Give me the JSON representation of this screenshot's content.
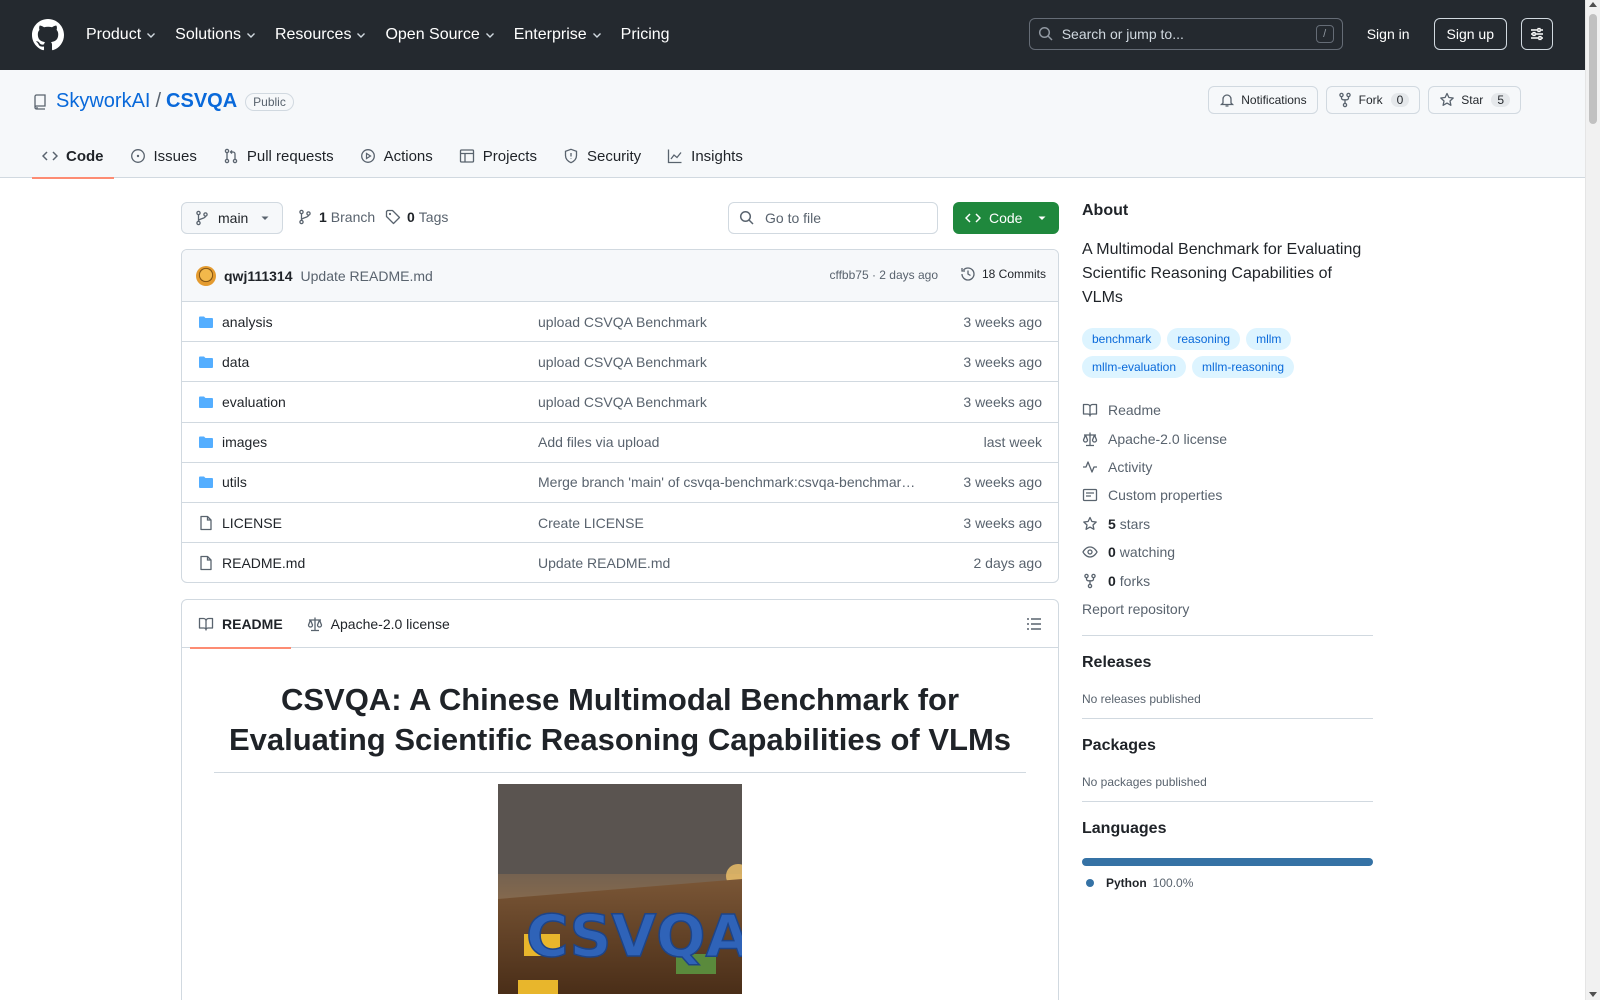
{
  "header": {
    "nav": [
      "Product",
      "Solutions",
      "Resources",
      "Open Source",
      "Enterprise",
      "Pricing"
    ],
    "search_placeholder": "Search or jump to...",
    "search_shortcut": "/",
    "sign_in": "Sign in",
    "sign_up": "Sign up"
  },
  "repo": {
    "owner": "SkyworkAI",
    "separator": "/",
    "name": "CSVQA",
    "visibility": "Public",
    "notifications_label": "Notifications",
    "fork_label": "Fork",
    "fork_count": "0",
    "star_label": "Star",
    "star_count": "5",
    "tabs": [
      "Code",
      "Issues",
      "Pull requests",
      "Actions",
      "Projects",
      "Security",
      "Insights"
    ]
  },
  "toolbar": {
    "branch": "main",
    "branch_count": "1",
    "branch_label": "Branch",
    "tag_count": "0",
    "tag_label": "Tags",
    "goto_placeholder": "Go to file",
    "code_button": "Code"
  },
  "latest_commit": {
    "author": "qwj111314",
    "message": "Update README.md",
    "meta": "cffbb75 · 2 days ago",
    "commits_label": "18 Commits"
  },
  "files": [
    {
      "name": "analysis",
      "type": "folder",
      "message": "upload CSVQA Benchmark",
      "age": "3 weeks ago"
    },
    {
      "name": "data",
      "type": "folder",
      "message": "upload CSVQA Benchmark",
      "age": "3 weeks ago"
    },
    {
      "name": "evaluation",
      "type": "folder",
      "message": "upload CSVQA Benchmark",
      "age": "3 weeks ago"
    },
    {
      "name": "images",
      "type": "folder",
      "message": "Add files via upload",
      "age": "last week"
    },
    {
      "name": "utils",
      "type": "folder",
      "message": "Merge branch 'main' of csvqa-benchmark:csvqa-benchmark…",
      "age": "3 weeks ago"
    },
    {
      "name": "LICENSE",
      "type": "file",
      "message": "Create LICENSE",
      "age": "3 weeks ago"
    },
    {
      "name": "README.md",
      "type": "file",
      "message": "Update README.md",
      "age": "2 days ago"
    }
  ],
  "readme": {
    "tab_readme": "README",
    "tab_license": "Apache-2.0 license",
    "title": "CSVQA: A Chinese Multimodal Benchmark for Evaluating Scientific Reasoning Capabilities of VLMs",
    "hero_text": "CSVQA"
  },
  "sidebar": {
    "about_heading": "About",
    "description": "A Multimodal Benchmark for Evaluating Scientific Reasoning Capabilities of VLMs",
    "topics": [
      "benchmark",
      "reasoning",
      "mllm",
      "mllm-evaluation",
      "mllm-reasoning"
    ],
    "readme_link": "Readme",
    "license_link": "Apache-2.0 license",
    "activity_link": "Activity",
    "custom_props_link": "Custom properties",
    "stars_count": "5",
    "stars_label": "stars",
    "watching_count": "0",
    "watching_label": "watching",
    "forks_count": "0",
    "forks_label": "forks",
    "report_link": "Report repository",
    "releases_heading": "Releases",
    "releases_text": "No releases published",
    "packages_heading": "Packages",
    "packages_text": "No packages published",
    "languages_heading": "Languages",
    "language_name": "Python",
    "language_pct": "100.0%",
    "language_share": 1.0,
    "language_color": "#3572a5"
  }
}
